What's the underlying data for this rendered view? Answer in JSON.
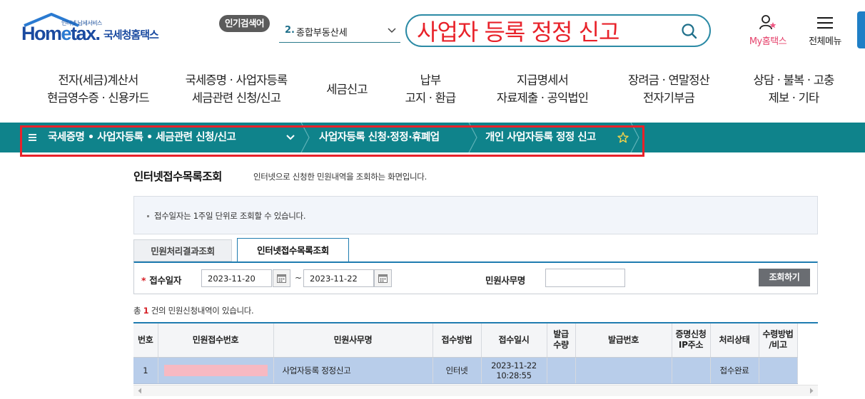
{
  "header": {
    "logo": {
      "subtitle": "인터넷 납세서비스",
      "brand_pre": "Hom",
      "brand_e": "e",
      "brand_post": "tax.",
      "brand_kr": "국세청홈택스"
    },
    "popular": {
      "badge": "인기검색어",
      "rank": "2.",
      "keyword": "종합부동산세"
    },
    "search": {
      "value": "사업자 등록 정정 신고"
    },
    "my_hometax": "My홈택스",
    "all_menu": "전체메뉴"
  },
  "main_nav": [
    {
      "line1": "전자(세금)계산서",
      "line2": "현금영수증 · 신용카드"
    },
    {
      "line1": "국세증명 · 사업자등록",
      "line2": "세금관련 신청/신고"
    },
    {
      "line1": "세금신고",
      "line2": ""
    },
    {
      "line1": "납부",
      "line2": "고지 · 환급"
    },
    {
      "line1": "지급명세서",
      "line2": "자료제출 · 공익법인"
    },
    {
      "line1": "장려금 · 연말정산",
      "line2": "전자기부금"
    },
    {
      "line1": "상담 · 불복 · 고충",
      "line2": "제보 · 기타"
    }
  ],
  "breadcrumb": {
    "level1": "국세증명 • 사업자등록 • 세금관련 신청/신고",
    "level2": "사업자등록 신청·정정·휴폐업",
    "level3": "개인 사업자등록 정정 신고"
  },
  "page": {
    "title": "인터넷접수목록조회",
    "description": "인터넷으로 신청한 민원내역을 조회하는 화면입니다.",
    "notice": "접수일자는 1주일 단위로 조회할 수 있습니다."
  },
  "tabs": {
    "result": "민원처리결과조회",
    "internet": "인터넷접수목록조회"
  },
  "search_form": {
    "required_mark": "*",
    "date_label": "접수일자",
    "date_from": "2023-11-20",
    "date_to": "2023-11-22",
    "tilde": "~",
    "service_label": "민원사무명",
    "service_value": "",
    "query_button": "조회하기"
  },
  "result_count": {
    "prefix": "총 ",
    "count": "1",
    "suffix": " 건의 민원신청내역이 있습니다."
  },
  "table": {
    "headers": [
      "번호",
      "민원접수번호",
      "민원사무명",
      "접수방법",
      "접수일시",
      "발급\n수량",
      "발급번호",
      "증명신청\nIP주소",
      "처리상태",
      "수령방법\n/비고"
    ],
    "rows": [
      {
        "no": "1",
        "service": "사업자등록 정정신고",
        "method": "인터넷",
        "date": "2023-11-22",
        "time": "10:28:55",
        "qty": "",
        "issue_no": "",
        "ip": "",
        "status": "접수완료",
        "note": ""
      }
    ]
  },
  "colors": {
    "teal_bar": "#0f838b",
    "highlight_red": "#e8222a",
    "brand_blue": "#1a4aa0",
    "row_selected": "#b8cdea"
  }
}
